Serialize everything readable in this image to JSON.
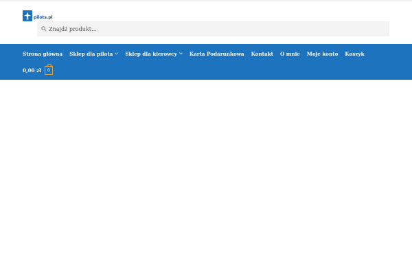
{
  "brand": {
    "logo_text": "pilots.pl"
  },
  "search": {
    "placeholder": "Znajdź produkt…",
    "icon": "search-icon"
  },
  "nav": {
    "items": [
      {
        "label": "Strona główna",
        "has_dropdown": false
      },
      {
        "label": "Sklep dla pilota",
        "has_dropdown": true
      },
      {
        "label": "Sklep dla kierowcy",
        "has_dropdown": true
      },
      {
        "label": "Karta Podarunkowa",
        "has_dropdown": false
      },
      {
        "label": "Kontakt",
        "has_dropdown": false
      },
      {
        "label": "O mnie",
        "has_dropdown": false
      },
      {
        "label": "Moje konto",
        "has_dropdown": false
      },
      {
        "label": "Koszyk",
        "has_dropdown": false
      }
    ]
  },
  "cart": {
    "amount": "0,00 zł",
    "count": "0"
  },
  "colors": {
    "nav_bg": "#1e73be",
    "cart_accent": "#e5a33a",
    "search_bg": "#f3f3f3"
  }
}
